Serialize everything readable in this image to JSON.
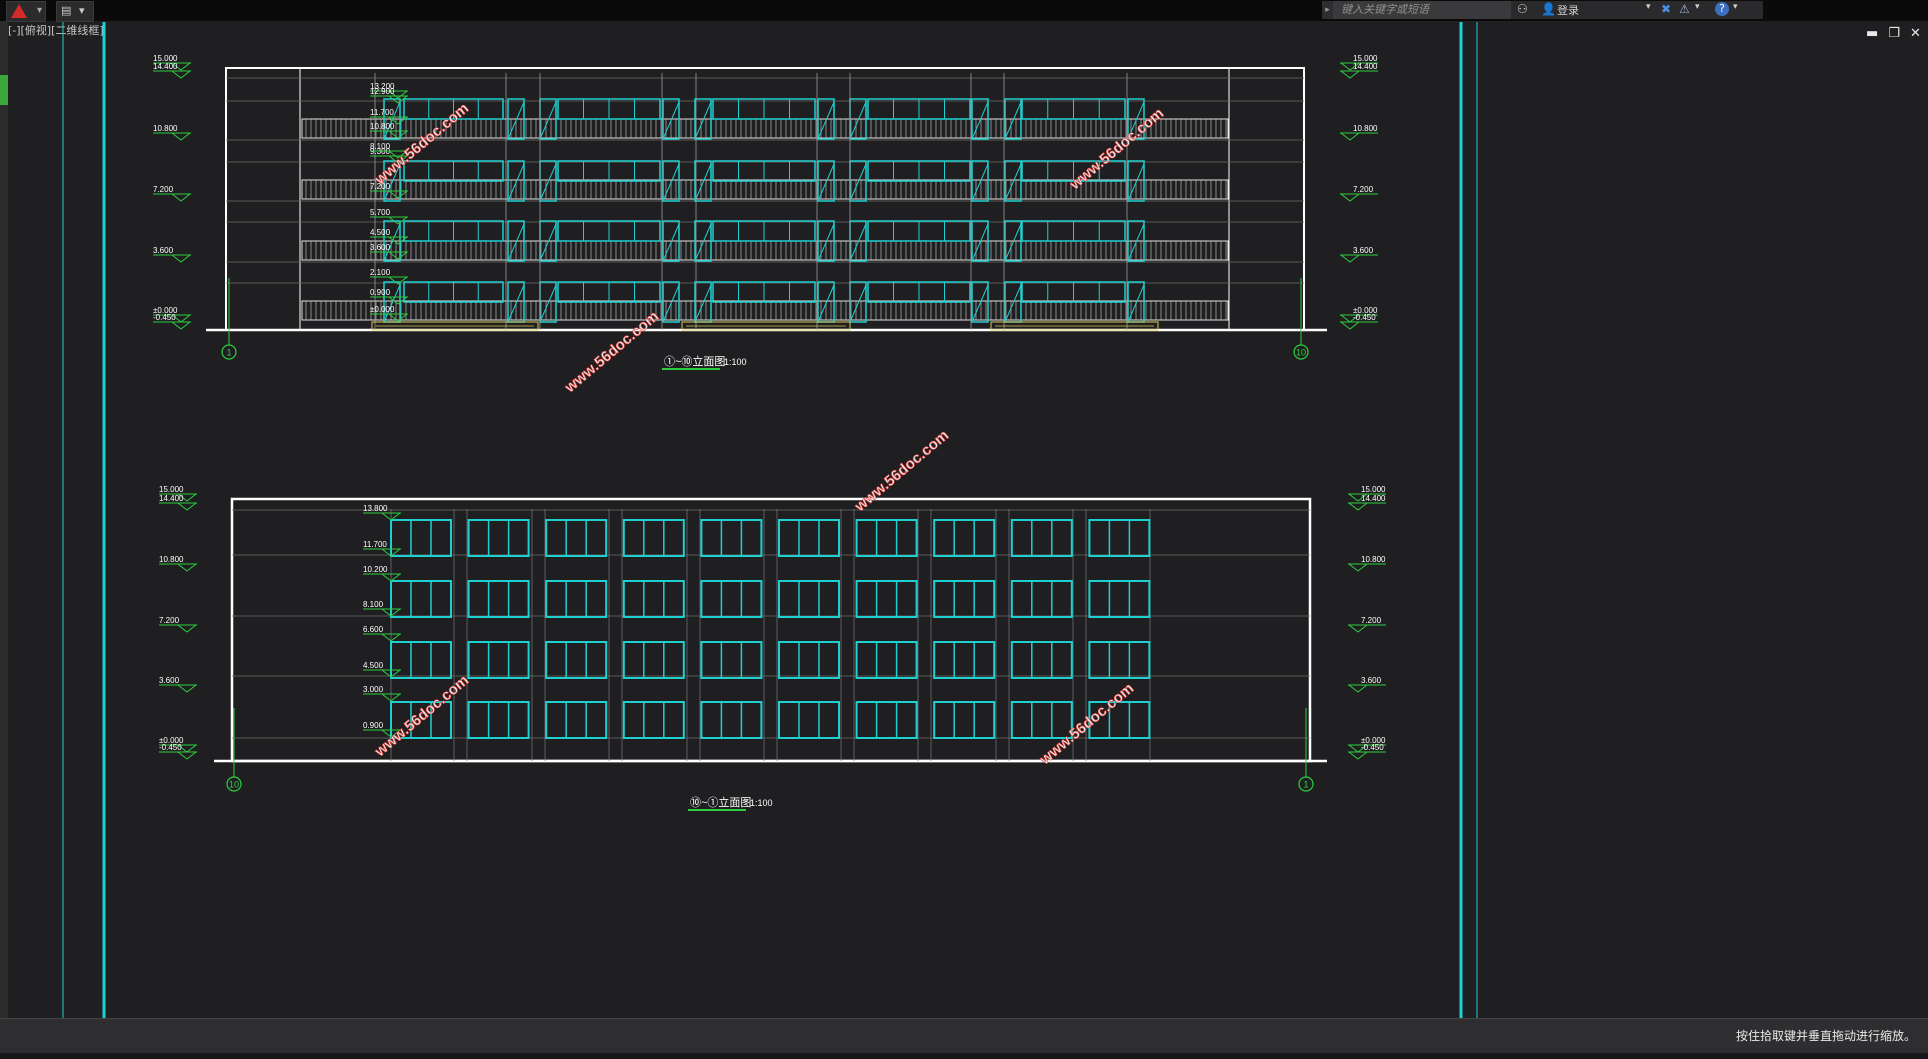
{
  "app": {
    "logo": "autocad-logo-icon",
    "search_placeholder": "键入关键字或短语",
    "login_label": "登录",
    "viewport_label": "[-][俯视][二维线框]"
  },
  "status": {
    "prompt": "按住拾取键并垂直拖动进行缩放。"
  },
  "elev_top": {
    "title": "①~⑩立面图",
    "scale": "1:100",
    "left_levels": [
      "15.000",
      "14.400",
      "10.800",
      "7.200",
      "3.600",
      "±0.000",
      "-0.450"
    ],
    "right_levels": [
      "15.000",
      "14.400",
      "10.800",
      "7.200",
      "3.600",
      "±0.000",
      "-0.450"
    ],
    "inner_levels": [
      "13.200",
      "12.900",
      "11.700",
      "10.800",
      "9.300",
      "8.100",
      "7.200",
      "5.700",
      "4.500",
      "3.600",
      "2.100",
      "0.900",
      "±0.000"
    ],
    "axis_left": "1",
    "axis_right": "10"
  },
  "elev_bottom": {
    "title": "⑩~①立面图",
    "scale": "1:100",
    "left_levels": [
      "15.000",
      "14.400",
      "10.800",
      "7.200",
      "3.600",
      "±0.000",
      "-0.450"
    ],
    "right_levels": [
      "15.000",
      "14.400",
      "10.800",
      "7.200",
      "3.600",
      "±0.000",
      "-0.450"
    ],
    "inner_levels": [
      "13.800",
      "11.700",
      "10.200",
      "8.100",
      "6.600",
      "4.500",
      "3.000",
      "0.900"
    ],
    "axis_left": "10",
    "axis_right": "1"
  },
  "watermark": "www.56doc.com",
  "colors": {
    "background": "#1f1f21",
    "outline": "#ffffff",
    "window": "#1fd0d0",
    "level": "#2ecc40",
    "grid": "#6c6c6c",
    "stair": "#d8c850"
  }
}
